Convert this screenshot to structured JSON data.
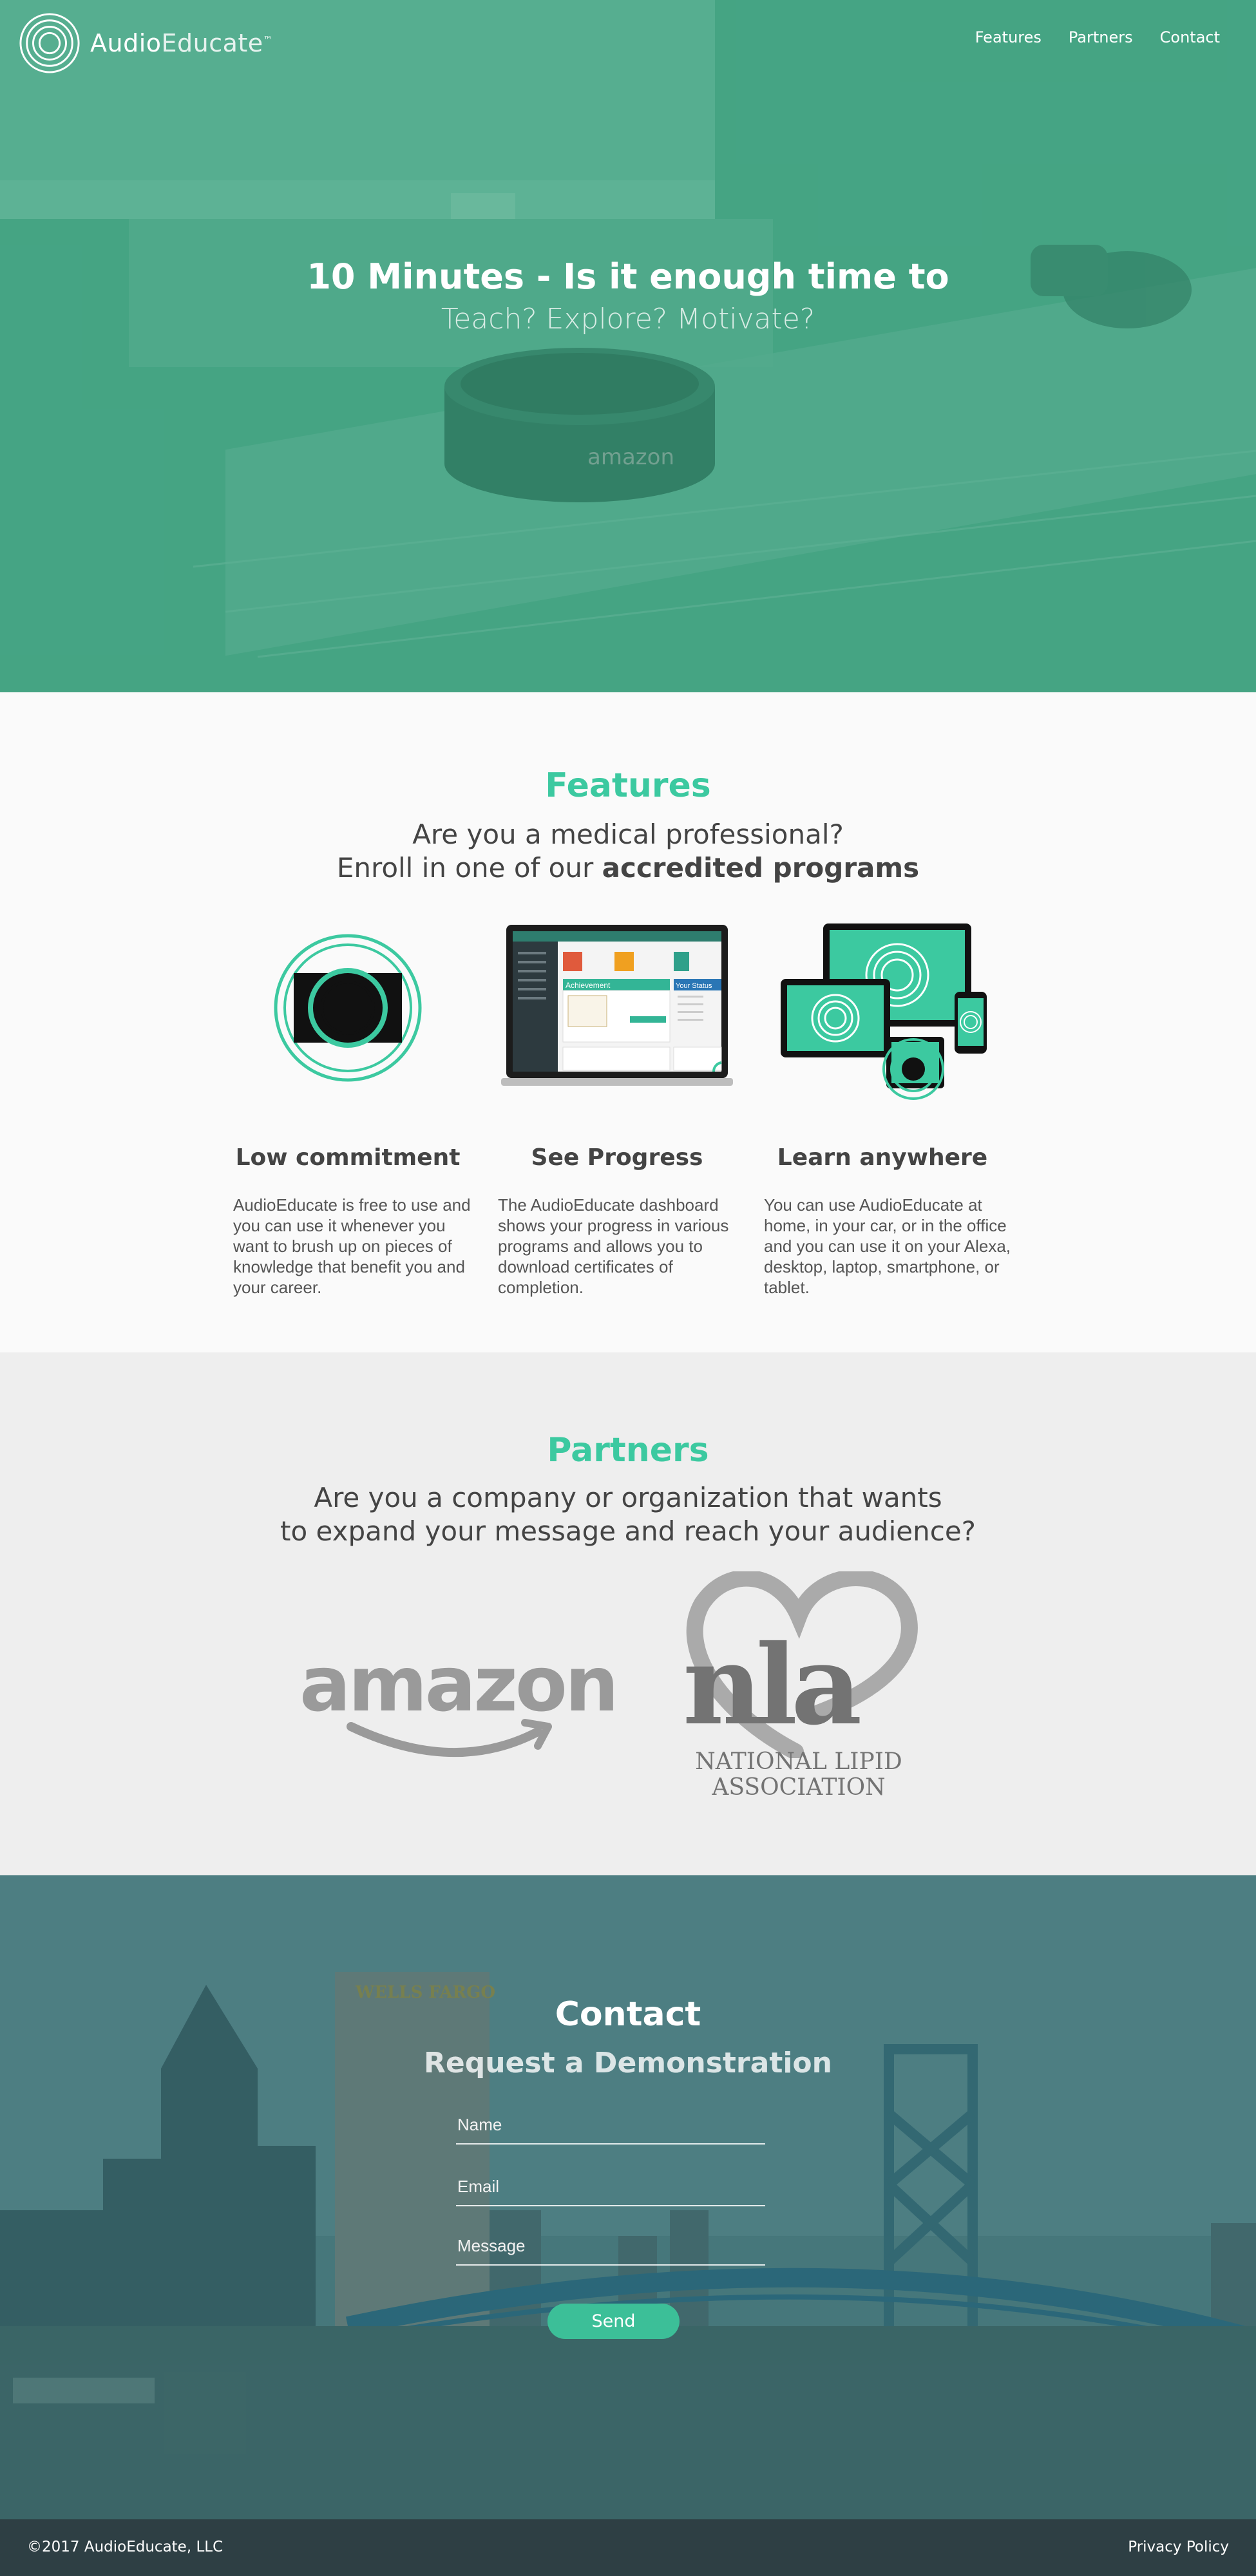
{
  "brand": {
    "name_bold": "Audio",
    "name_light": "Educate",
    "tm": "™"
  },
  "nav": {
    "items": [
      "Features",
      "Partners",
      "Contact"
    ]
  },
  "hero": {
    "title": "10 Minutes - Is it enough time to",
    "subtitle": "Teach? Explore? Motivate?",
    "device_label": "amazon"
  },
  "features": {
    "heading": "Features",
    "lead_line1": "Are you a medical professional?",
    "lead_line2_prefix": "Enroll in one of our ",
    "lead_line2_bold": "accredited programs",
    "items": [
      {
        "title": "Low commitment",
        "body": "AudioEducate is free to use and you can use it whenever you want to brush up on pieces of knowledge that benefit you and your career."
      },
      {
        "title": "See Progress",
        "body": "The AudioEducate dashboard shows your progress in various programs and allows you to download certificates of completion."
      },
      {
        "title": "Learn anywhere",
        "body": "You can use AudioEducate at home, in your car, or in the office and you can use it on your Alexa, desktop, laptop, smartphone, or tablet."
      }
    ],
    "dashboard": {
      "card_title": "Achievement",
      "side_title": "Your Status"
    }
  },
  "partners": {
    "heading": "Partners",
    "lead_line1": "Are you a company or organization that wants",
    "lead_line2": "to expand your message and reach your audience?",
    "logos": {
      "amazon": "amazon",
      "nla_mark": "nla",
      "nla_line1": "NATIONAL LIPID",
      "nla_line2": "ASSOCIATION"
    }
  },
  "contact": {
    "heading": "Contact",
    "subheading": "Request a Demonstration",
    "name_placeholder": "Name",
    "email_placeholder": "Email",
    "message_placeholder": "Message",
    "send_label": "Send",
    "building_sign": "WELLS FARGO"
  },
  "footer": {
    "copyright": "©2017  AudioEducate, LLC",
    "privacy": "Privacy Policy"
  },
  "colors": {
    "accent": "#3cc9a0",
    "hero_tint": "#4e9a80",
    "footer": "#2e3f44",
    "partners_bg": "#eeeeee"
  }
}
